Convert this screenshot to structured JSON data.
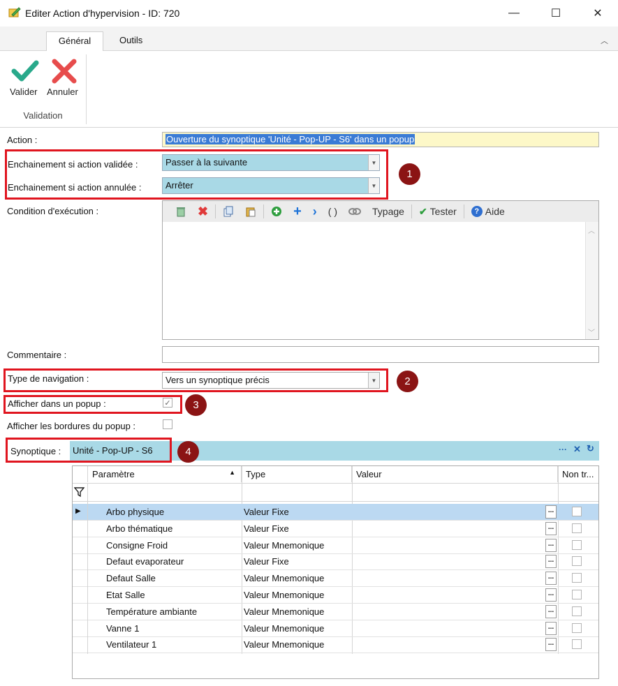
{
  "window": {
    "title": "Editer Action d'hypervision - ID: 720",
    "controls": {
      "minimize": "—",
      "maximize": "☐",
      "close": "✕"
    }
  },
  "ribbon": {
    "tabs": [
      {
        "label": "Général"
      },
      {
        "label": "Outils"
      }
    ],
    "group_label": "Validation",
    "validate_label": "Valider",
    "cancel_label": "Annuler",
    "collapse_icon": "chevron-up-icon"
  },
  "form": {
    "action_label": "Action :",
    "action_value": "Ouverture du synoptique 'Unité - Pop-UP - S6' dans un popup",
    "chain_validated_label": "Enchainement si action validée :",
    "chain_validated_value": "Passer à la suivante",
    "chain_cancelled_label": "Enchainement si action annulée :",
    "chain_cancelled_value": "Arrêter",
    "condition_label": "Condition d'exécution :",
    "condition_toolbar": {
      "parens": "( )",
      "typing": "Typage",
      "test": "Tester",
      "help": "Aide"
    },
    "comment_label": "Commentaire :",
    "comment_value": "",
    "nav_type_label": "Type de navigation :",
    "nav_type_value": "Vers un synoptique précis",
    "popup_label": "Afficher dans un popup :",
    "popup_checked": true,
    "popup_borders_label": "Afficher les bordures du popup :",
    "popup_borders_checked": false,
    "synoptique_label": "Synoptique :",
    "synoptique_value": "Unité - Pop-UP - S6"
  },
  "badges": [
    "1",
    "2",
    "3",
    "4"
  ],
  "grid": {
    "columns": [
      "Paramètre",
      "Type",
      "Valeur",
      "Non tr..."
    ],
    "ellipsis": "...",
    "rows": [
      {
        "param": "Arbo physique",
        "type": "Valeur Fixe",
        "value": ""
      },
      {
        "param": "Arbo thématique",
        "type": "Valeur Fixe",
        "value": ""
      },
      {
        "param": "Consigne Froid",
        "type": "Valeur Mnemonique",
        "value": ""
      },
      {
        "param": "Defaut evaporateur",
        "type": "Valeur Fixe",
        "value": ""
      },
      {
        "param": "Defaut Salle",
        "type": "Valeur Mnemonique",
        "value": ""
      },
      {
        "param": "Etat Salle",
        "type": "Valeur Mnemonique",
        "value": ""
      },
      {
        "param": "Température ambiante",
        "type": "Valeur Mnemonique",
        "value": ""
      },
      {
        "param": "Vanne 1",
        "type": "Valeur Mnemonique",
        "value": ""
      },
      {
        "param": "Ventilateur 1",
        "type": "Valeur Mnemonique",
        "value": ""
      }
    ]
  }
}
